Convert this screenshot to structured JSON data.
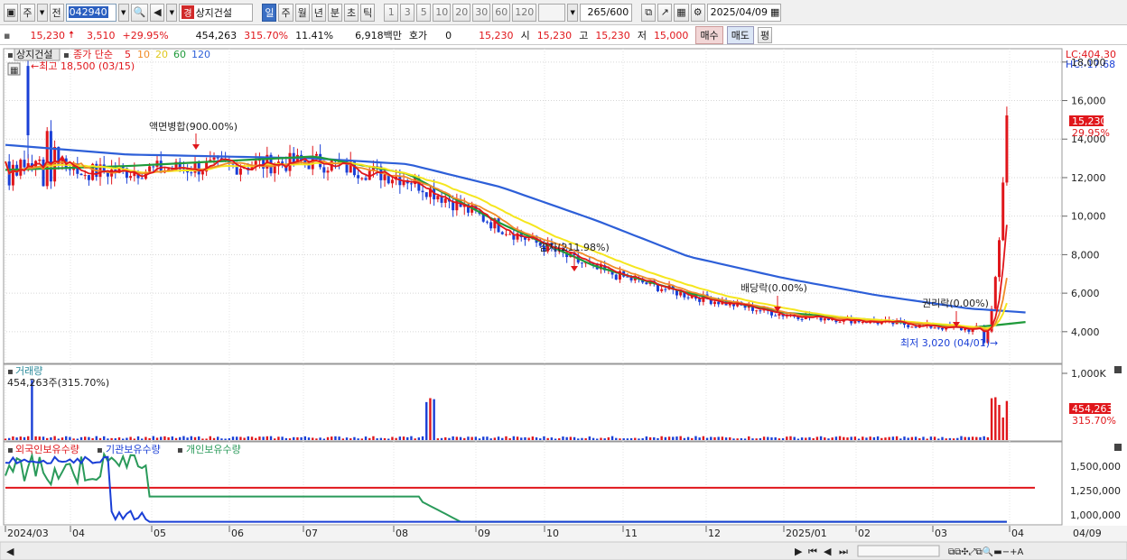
{
  "toolbar": {
    "type_label": "주",
    "prev_label": "전",
    "stock_code": "042940",
    "stock_badge": "경",
    "stock_name": "상지건설",
    "periods": [
      "일",
      "주",
      "월",
      "년",
      "분",
      "초",
      "틱"
    ],
    "selected_period": "일",
    "intervals": [
      "1",
      "3",
      "5",
      "10",
      "20",
      "30",
      "60",
      "120"
    ],
    "count_value": "265",
    "count_max": "/600",
    "date": "2025/04/09"
  },
  "quote": {
    "price": "15,230",
    "change": "3,510",
    "change_pct": "+29.95%",
    "volume": "454,263",
    "volume_ratio": "315.70%",
    "turnover": "11.41%",
    "amount": "6,918백만",
    "hoga_label": "호가",
    "hoga_value": "0",
    "price2": "15,230",
    "open_label": "시",
    "open_value": "15,230",
    "high_label": "고",
    "high_value": "15,230",
    "low_label": "저",
    "low_value": "15,000",
    "buy_label": "매수",
    "sell_label": "매도",
    "avg_label": "평"
  },
  "colors": {
    "up": "#e0161b",
    "down": "#1a3fd6",
    "ma5": "#e0161b",
    "ma10": "#f08c28",
    "ma20": "#f5e61e",
    "ma60": "#1f9a3a",
    "ma120": "#2d5fd8",
    "foreign": "#1a3fd6",
    "institution": "#2a9a5a",
    "individual": "#e0161b"
  },
  "chart_data": [
    {
      "type": "candlestick",
      "legend": {
        "name": "상지건설",
        "price_label": "종가 단순",
        "periods": [
          "5",
          "10",
          "20",
          "60",
          "120"
        ]
      },
      "corner_labels": [
        "LC:404.30",
        "HC:-17.68"
      ],
      "ylim": [
        2400,
        18600
      ],
      "y_ticks": [
        "4,000",
        "6,000",
        "8,000",
        "10,000",
        "12,000",
        "14,000",
        "16,000",
        "18,000"
      ],
      "y_tick_values": [
        4000,
        6000,
        8000,
        10000,
        12000,
        14000,
        16000,
        18000
      ],
      "last_price_label": "15,230",
      "last_change_label": "29.95%",
      "last_price": 15230,
      "annotations": {
        "high_label": "최고 18,500 (03/15)",
        "low_label": "최저 3,020 (04/01)",
        "events": [
          "액면병합(900.00%)",
          "감자(211.98%)",
          "배당락(0.00%)",
          "권리락(0.00%)"
        ]
      },
      "x_ticks": [
        "2024/03",
        "04",
        "05",
        "06",
        "07",
        "08",
        "09",
        "10",
        "11",
        "12",
        "2025/01",
        "02",
        "03",
        "04"
      ],
      "x_ticks_right": "04/09",
      "ma120_points": [
        [
          2024.17,
          13700
        ],
        [
          2024.3,
          13200
        ],
        [
          2024.5,
          13000
        ],
        [
          2024.6,
          12700
        ],
        [
          2024.7,
          11500
        ],
        [
          2024.8,
          9800
        ],
        [
          2024.9,
          7900
        ],
        [
          2025.0,
          6800
        ],
        [
          2025.1,
          5900
        ],
        [
          2025.2,
          5200
        ],
        [
          2025.26,
          5000
        ]
      ],
      "ma60_points": [
        [
          2024.17,
          12400
        ],
        [
          2024.3,
          12600
        ],
        [
          2024.5,
          13100
        ],
        [
          2024.6,
          12200
        ],
        [
          2024.7,
          9600
        ],
        [
          2024.8,
          7400
        ],
        [
          2024.9,
          6000
        ],
        [
          2025.0,
          5000
        ],
        [
          2025.1,
          4600
        ],
        [
          2025.2,
          4200
        ],
        [
          2025.26,
          4500
        ]
      ]
    },
    {
      "type": "bar",
      "title": "거래량",
      "current_label": "454,263주(315.70%)",
      "y_ticks": [
        "1,000K"
      ],
      "last_value_label": "454,263",
      "last_ratio_label": "315.70%"
    },
    {
      "type": "line",
      "series": [
        {
          "name": "외국인보유수량"
        },
        {
          "name": "기관보유수량"
        },
        {
          "name": "개인보유수량"
        }
      ],
      "y_ticks": [
        "1,500,000",
        "1,250,000",
        "1,000,000"
      ]
    }
  ]
}
